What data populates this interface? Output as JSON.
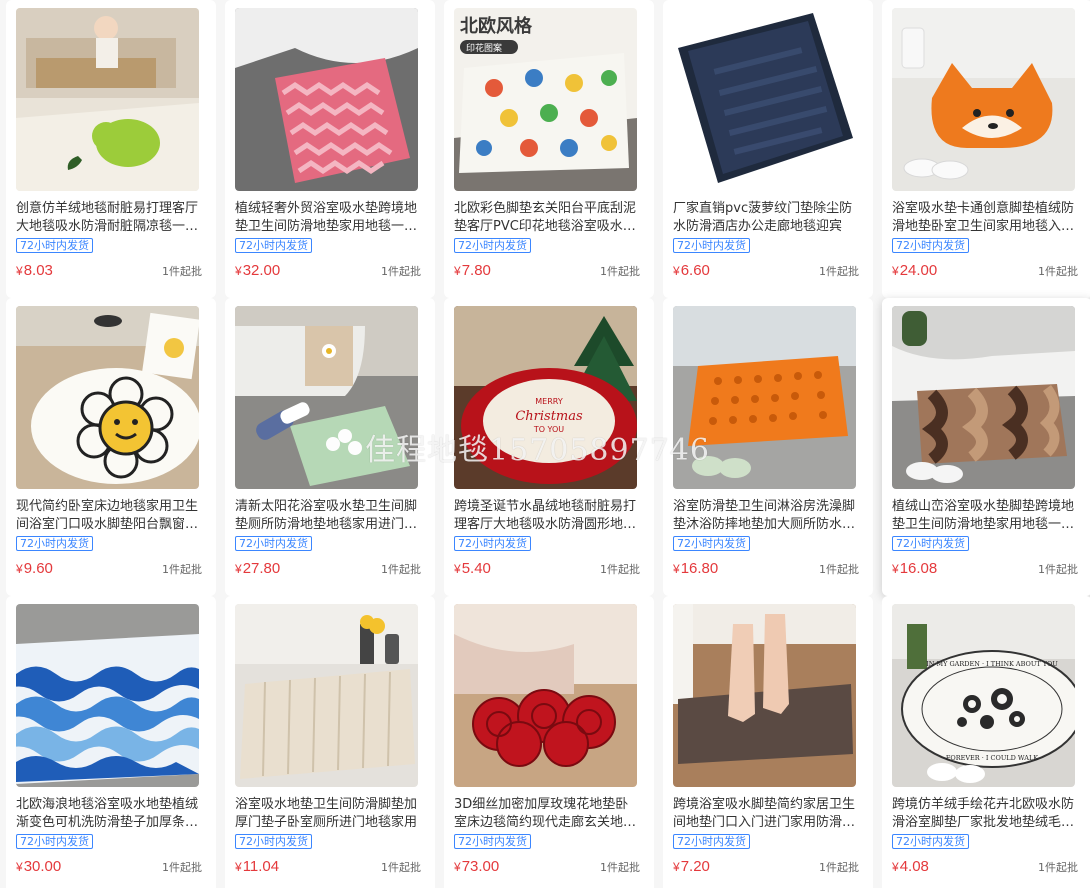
{
  "products": [
    {
      "title": "创意仿羊绒地毯耐脏易打理客厅大地毯吸水防滑耐脏隔凉毯一…",
      "badge": "72小时内发货",
      "price": "8.03",
      "moq": "1件起批",
      "image_icon": "pear-rug-image"
    },
    {
      "title": "植绒轻奢外贸浴室吸水垫跨境地垫卫生间防滑地垫家用地毯一…",
      "badge": "72小时内发货",
      "price": "32.00",
      "moq": "1件起批",
      "image_icon": "pink-zigzag-mat-image"
    },
    {
      "title": "北欧彩色脚垫玄关阳台平底刮泥垫客厅PVC印花地毯浴室吸水…",
      "badge": "72小时内发货",
      "price": "7.80",
      "moq": "1件起批",
      "image_icon": "polka-dot-mat-image",
      "image_text": [
        "北欧风格",
        "印花图案"
      ]
    },
    {
      "title": "厂家直销pvc菠萝纹门垫除尘防水防滑酒店办公走廊地毯迎宾",
      "badge": "72小时内发货",
      "price": "6.60",
      "moq": "1件起批",
      "image_icon": "navy-door-mat-image"
    },
    {
      "title": "浴室吸水垫卡通创意脚垫植绒防滑地垫卧室卫生间家用地毯入…",
      "badge": "72小时内发货",
      "price": "24.00",
      "moq": "1件起批",
      "image_icon": "fox-mat-image"
    },
    {
      "title": "现代简约卧室床边地毯家用卫生间浴室门口吸水脚垫阳台飘窗…",
      "badge": "72小时内发货",
      "price": "9.60",
      "moq": "1件起批",
      "image_icon": "smiley-flower-rug-image"
    },
    {
      "title": "清新太阳花浴室吸水垫卫生间脚垫厕所防滑地垫地毯家用进门…",
      "badge": "72小时内发货",
      "price": "27.80",
      "moq": "1件起批",
      "image_icon": "daisy-bath-mat-image"
    },
    {
      "title": "跨境圣诞节水晶绒地毯耐脏易打理客厅大地毯吸水防滑圆形地…",
      "badge": "72小时内发货",
      "price": "5.40",
      "moq": "1件起批",
      "image_icon": "christmas-round-rug-image",
      "image_text": [
        "MERRY",
        "Christmas",
        "TO YOU"
      ]
    },
    {
      "title": "浴室防滑垫卫生间淋浴房洗澡脚垫沐浴防摔地垫加大厕所防水…",
      "badge": "72小时内发货",
      "price": "16.80",
      "moq": "1件起批",
      "image_icon": "orange-shower-mat-image"
    },
    {
      "title": "植绒山峦浴室吸水垫脚垫跨境地垫卫生间防滑地垫家用地毯一…",
      "badge": "72小时内发货",
      "price": "16.08",
      "moq": "1件起批",
      "image_icon": "brown-wave-mat-image"
    },
    {
      "title": "北欧海浪地毯浴室吸水地垫植绒渐变色可机洗防滑垫子加厚条…",
      "badge": "72小时内发货",
      "price": "30.00",
      "moq": "1件起批",
      "image_icon": "blue-wave-mat-image"
    },
    {
      "title": "浴室吸水地垫卫生间防滑脚垫加厚门垫子卧室厕所进门地毯家用",
      "badge": "72小时内发货",
      "price": "11.04",
      "moq": "1件起批",
      "image_icon": "beige-memory-foam-mat-image"
    },
    {
      "title": "3D细丝加密加厚玫瑰花地垫卧室床边毯简约现代走廊玄关地毯…",
      "badge": "72小时内发货",
      "price": "73.00",
      "moq": "1件起批",
      "image_icon": "red-rose-rug-image"
    },
    {
      "title": "跨境浴室吸水脚垫简约家居卫生间地垫门口入门进门家用防滑…",
      "badge": "72小时内发货",
      "price": "7.20",
      "moq": "1件起批",
      "image_icon": "brown-plush-mat-image"
    },
    {
      "title": "跨境仿羊绒手绘花卉北欧吸水防滑浴室脚垫厂家批发地垫绒毛…",
      "badge": "72小时内发货",
      "price": "4.08",
      "moq": "1件起批",
      "image_icon": "floral-oval-mat-image",
      "image_text": [
        "IN MY GARDEN · I THINK ABOUT YOU",
        "FOREVER · I COULD WALK"
      ]
    }
  ],
  "currency_symbol": "¥",
  "watermark": "佳程地毯15705897746",
  "colors": {
    "price": "#e4393c",
    "badge": "#3b86ff"
  }
}
